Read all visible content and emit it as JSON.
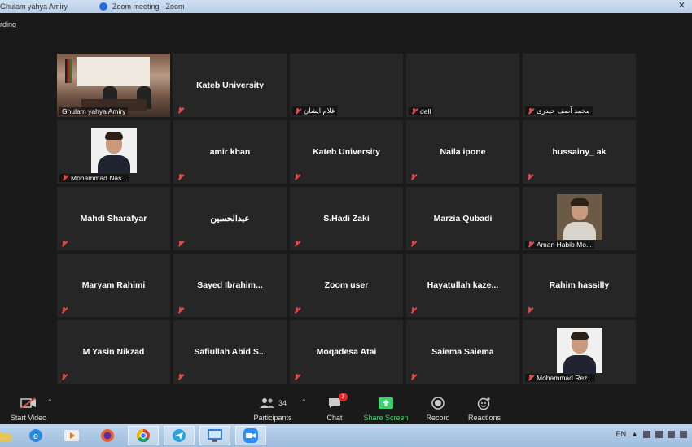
{
  "window": {
    "tab_left": "Ghulam yahya Amiry",
    "tab_right": "Zoom meeting - Zoom",
    "recording_label": "rding"
  },
  "participants": [
    {
      "display": "",
      "footer": "Ghulam yahya Amiry",
      "kind": "video",
      "active": true,
      "muted": false
    },
    {
      "display": "Kateb University",
      "footer": "",
      "kind": "name",
      "muted": true
    },
    {
      "display": "",
      "footer": "غلام ایشان",
      "kind": "name",
      "muted": true
    },
    {
      "display": "",
      "footer": "dell",
      "kind": "name",
      "muted": true
    },
    {
      "display": "",
      "footer": "محمد آصف حیدری",
      "kind": "name",
      "muted": true
    },
    {
      "display": "",
      "footer": "Mohammad Nas...",
      "kind": "photo",
      "muted": true
    },
    {
      "display": "amir khan",
      "footer": "",
      "kind": "name",
      "muted": true
    },
    {
      "display": "Kateb University",
      "footer": "",
      "kind": "name",
      "muted": true
    },
    {
      "display": "Naila ipone",
      "footer": "",
      "kind": "name",
      "muted": true
    },
    {
      "display": "hussainy_ ak",
      "footer": "",
      "kind": "name",
      "muted": true
    },
    {
      "display": "Mahdi Sharafyar",
      "footer": "",
      "kind": "name",
      "muted": true
    },
    {
      "display": "عبدالحسین",
      "footer": "",
      "kind": "name",
      "muted": true
    },
    {
      "display": "S.Hadi Zaki",
      "footer": "",
      "kind": "name",
      "muted": true
    },
    {
      "display": "Marzia Qubadi",
      "footer": "",
      "kind": "name",
      "muted": true
    },
    {
      "display": "",
      "footer": "Aman Habib Mo...",
      "kind": "photo-dark",
      "muted": true
    },
    {
      "display": "Maryam Rahimi",
      "footer": "",
      "kind": "name",
      "muted": true
    },
    {
      "display": "Sayed  Ibrahim...",
      "footer": "",
      "kind": "name",
      "muted": true
    },
    {
      "display": "Zoom user",
      "footer": "",
      "kind": "name",
      "muted": true
    },
    {
      "display": "Hayatullah  kaze...",
      "footer": "",
      "kind": "name",
      "muted": true
    },
    {
      "display": "Rahim hassilly",
      "footer": "",
      "kind": "name",
      "muted": true
    },
    {
      "display": "M Yasin Nikzad",
      "footer": "",
      "kind": "name",
      "muted": true
    },
    {
      "display": "Safiullah  Abid  S...",
      "footer": "",
      "kind": "name",
      "muted": true
    },
    {
      "display": "Moqadesa Atai",
      "footer": "",
      "kind": "name",
      "muted": true
    },
    {
      "display": "Saiema Saiema",
      "footer": "",
      "kind": "name",
      "muted": true
    },
    {
      "display": "",
      "footer": "Mohammad Rez...",
      "kind": "photo",
      "muted": true
    }
  ],
  "toolbar": {
    "start_video": "Start Video",
    "participants": "Participants",
    "participants_count": "34",
    "chat": "Chat",
    "chat_badge": "3",
    "share_screen": "Share Screen",
    "record": "Record",
    "reactions": "Reactions"
  },
  "taskbar": {
    "language": "EN"
  },
  "colors": {
    "active_speaker": "#d8e84a",
    "share_green": "#3bd46b",
    "mute_red": "#e04848"
  }
}
